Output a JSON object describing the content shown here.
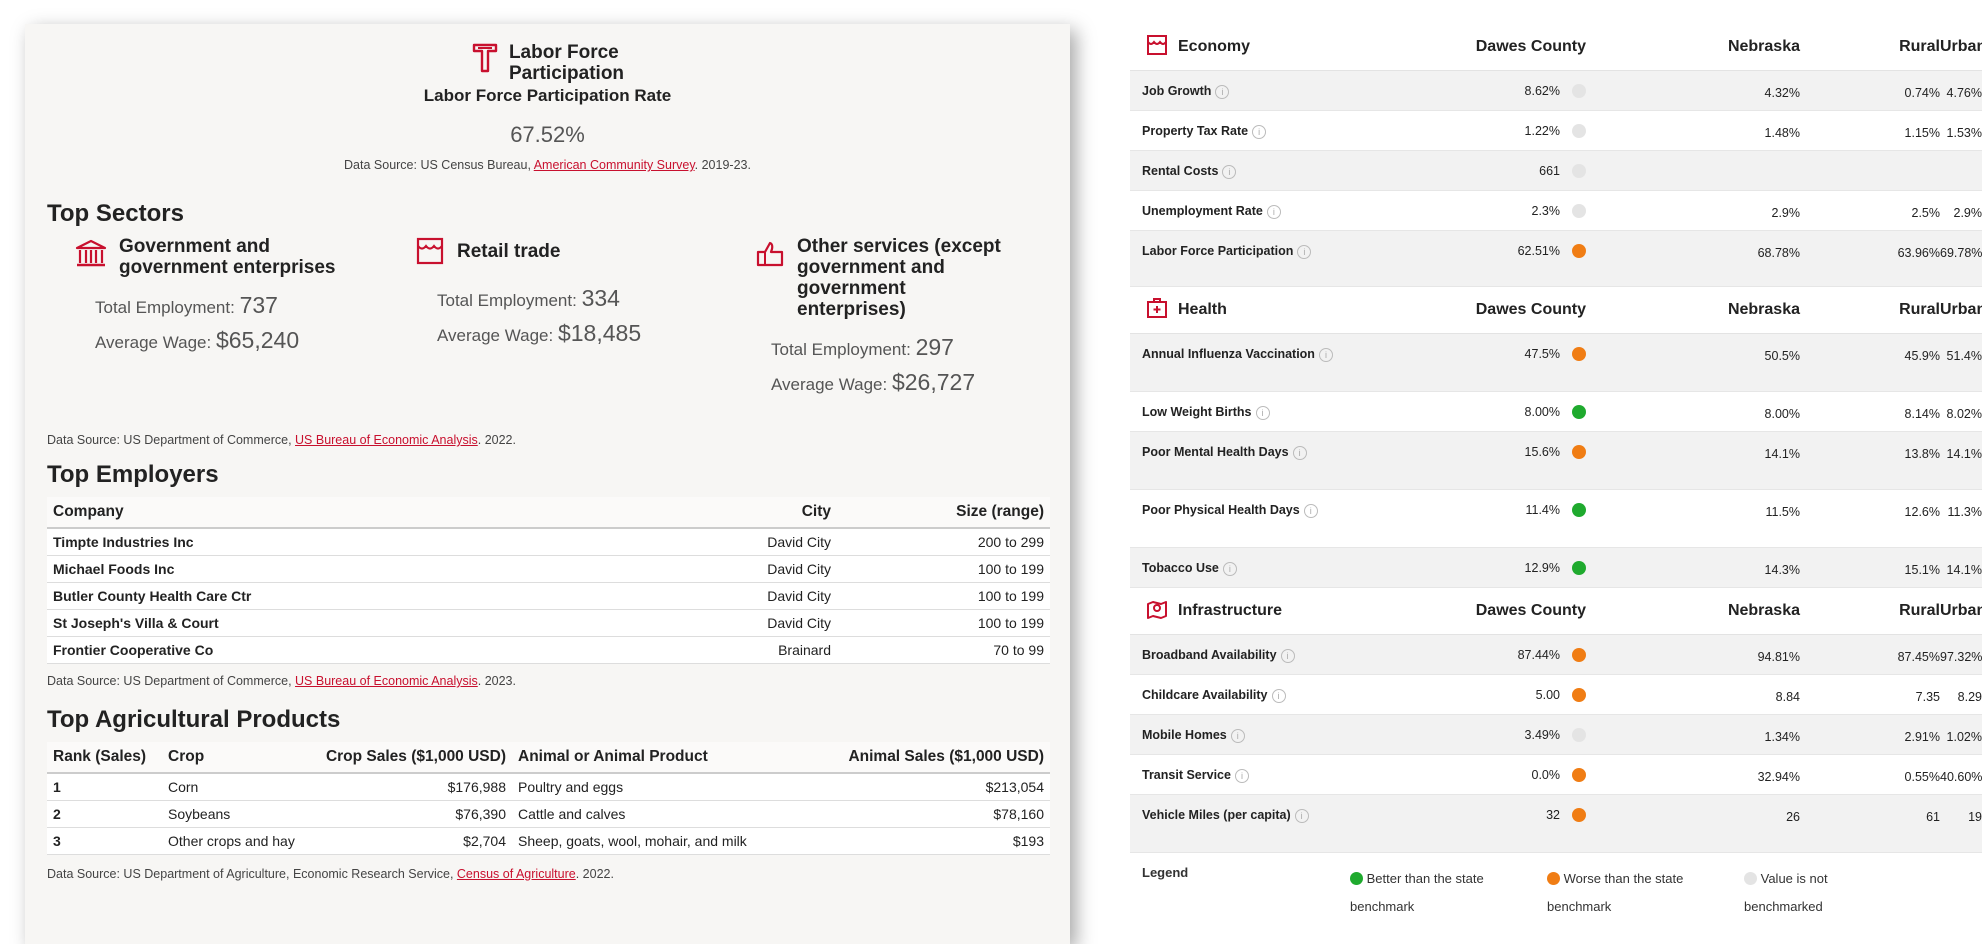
{
  "colors": {
    "accent": "#c8102e",
    "green": "#1faa2e",
    "orange": "#f07d14",
    "gray": "#e4e4e4"
  },
  "lfp": {
    "title_line1": "Labor Force",
    "title_line2": "Participation",
    "subtitle": "Labor Force Participation Rate",
    "value": "67.52%",
    "source_prefix": "Data Source: US Census Bureau, ",
    "source_link": "American Community Survey",
    "source_suffix": ". 2019-23."
  },
  "sectors": {
    "title": "Top Sectors",
    "emp_label": "Total Employment: ",
    "wage_label": "Average Wage: ",
    "items": [
      {
        "line1": "Government and",
        "line2": "government enterprises",
        "line3": "",
        "line4": "",
        "employment": "737",
        "wage": "$65,240",
        "icon": "building-icon"
      },
      {
        "line1": "Retail trade",
        "line2": "",
        "line3": "",
        "line4": "",
        "employment": "334",
        "wage": "$18,485",
        "icon": "storefront-icon"
      },
      {
        "line1": "Other services (except",
        "line2": "government and",
        "line3": "government",
        "line4": "enterprises)",
        "employment": "297",
        "wage": "$26,727",
        "icon": "hand-icon"
      }
    ],
    "source_prefix": "Data Source: US Department of Commerce, ",
    "source_link": "US Bureau of Economic Analysis",
    "source_suffix": ". 2022."
  },
  "employers": {
    "title": "Top Employers",
    "headers": [
      "Company",
      "City",
      "Size (range)"
    ],
    "rows": [
      [
        "Timpte Industries Inc",
        "David City",
        "200 to 299"
      ],
      [
        "Michael Foods Inc",
        "David City",
        "100 to 199"
      ],
      [
        "Butler County Health Care Ctr",
        "David City",
        "100 to 199"
      ],
      [
        "St Joseph's Villa & Court",
        "David City",
        "100 to 199"
      ],
      [
        "Frontier Cooperative Co",
        "Brainard",
        "70 to 99"
      ]
    ],
    "source_prefix": "Data Source: US Department of Commerce, ",
    "source_link": "US Bureau of Economic Analysis",
    "source_suffix": ". 2023."
  },
  "ag": {
    "title": "Top Agricultural Products",
    "headers": [
      "Rank (Sales)",
      "Crop",
      "Crop Sales ($1,000 USD)",
      "Animal or Animal Product",
      "Animal Sales ($1,000 USD)"
    ],
    "rows": [
      [
        "1",
        "Corn",
        "$176,988",
        "Poultry and eggs",
        "$213,054"
      ],
      [
        "2",
        "Soybeans",
        "$76,390",
        "Cattle and calves",
        "$78,160"
      ],
      [
        "3",
        "Other crops and hay",
        "$2,704",
        "Sheep, goats, wool, mohair, and milk",
        "$193"
      ]
    ],
    "source_prefix": "Data Source: US Department of Agriculture, Economic Research Service, ",
    "source_link": "Census of Agriculture",
    "source_suffix": ". 2022."
  },
  "columns": [
    "Dawes County",
    "Nebraska",
    "Rural",
    "Urban"
  ],
  "info_glyph": "i",
  "economy": {
    "title": "Economy",
    "rows": [
      {
        "name": "Job Growth",
        "county": "8.62%",
        "status": "gray",
        "ne": "4.32%",
        "rural": "0.74%",
        "urban": "4.76%",
        "h": 40
      },
      {
        "name": "Property Tax Rate",
        "county": "1.22%",
        "status": "gray",
        "ne": "1.48%",
        "rural": "1.15%",
        "urban": "1.53%",
        "h": 40
      },
      {
        "name": "Rental Costs",
        "county": "661",
        "status": "gray",
        "ne": "",
        "rural": "",
        "urban": "",
        "h": 40
      },
      {
        "name": "Unemployment Rate",
        "county": "2.3%",
        "status": "gray",
        "ne": "2.9%",
        "rural": "2.5%",
        "urban": "2.9%",
        "h": 40
      },
      {
        "name": "Labor Force Participation",
        "county": "62.51%",
        "status": "orange",
        "ne": "68.78%",
        "rural": "63.96%",
        "urban": "69.78%",
        "h": 56
      }
    ]
  },
  "health": {
    "title": "Health",
    "rows": [
      {
        "name": "Annual Influenza Vaccination",
        "county": "47.5%",
        "status": "orange",
        "ne": "50.5%",
        "rural": "45.9%",
        "urban": "51.4%",
        "h": 58
      },
      {
        "name": "Low Weight Births",
        "county": "8.00%",
        "status": "green",
        "ne": "8.00%",
        "rural": "8.14%",
        "urban": "8.02%",
        "h": 40
      },
      {
        "name": "Poor Mental Health Days",
        "county": "15.6%",
        "status": "orange",
        "ne": "14.1%",
        "rural": "13.8%",
        "urban": "14.1%",
        "h": 58
      },
      {
        "name": "Poor Physical Health Days",
        "county": "11.4%",
        "status": "green",
        "ne": "11.5%",
        "rural": "12.6%",
        "urban": "11.3%",
        "h": 58
      },
      {
        "name": "Tobacco Use",
        "county": "12.9%",
        "status": "green",
        "ne": "14.3%",
        "rural": "15.1%",
        "urban": "14.1%",
        "h": 40
      }
    ]
  },
  "infra": {
    "title": "Infrastructure",
    "rows": [
      {
        "name": "Broadband Availability",
        "county": "87.44%",
        "status": "orange",
        "ne": "94.81%",
        "rural": "87.45%",
        "urban": "97.32%",
        "h": 40
      },
      {
        "name": "Childcare Availability",
        "county": "5.00",
        "status": "orange",
        "ne": "8.84",
        "rural": "7.35",
        "urban": "8.29",
        "h": 40
      },
      {
        "name": "Mobile Homes",
        "county": "3.49%",
        "status": "gray",
        "ne": "1.34%",
        "rural": "2.91%",
        "urban": "1.02%",
        "h": 40
      },
      {
        "name": "Transit Service",
        "county": "0.0%",
        "status": "orange",
        "ne": "32.94%",
        "rural": "0.55%",
        "urban": "40.60%",
        "h": 40
      },
      {
        "name": "Vehicle Miles (per capita)",
        "county": "32",
        "status": "orange",
        "ne": "26",
        "rural": "61",
        "urban": "19",
        "h": 58
      }
    ]
  },
  "legend": {
    "title": "Legend",
    "better_line1": "Better than the state",
    "better_line2": "benchmark",
    "worse_line1": "Worse than the state",
    "worse_line2": "benchmark",
    "na_line1": "Value is not",
    "na_line2": "benchmarked"
  }
}
